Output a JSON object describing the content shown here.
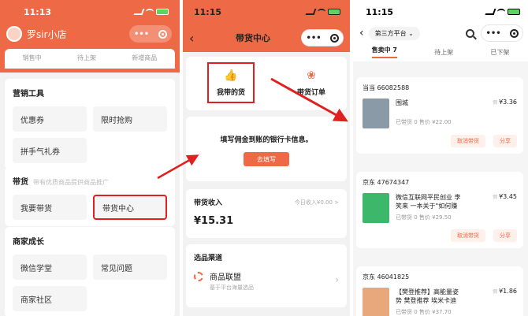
{
  "status_time": "11:13",
  "status_time_2": "11:15",
  "status_time_3": "11:15",
  "panel1": {
    "shop_name": "罗sir小店",
    "order_status": [
      "销售中",
      "待上架",
      "新增商品"
    ],
    "marketing": {
      "title": "营销工具",
      "items": [
        "优惠券",
        "限时抢购",
        "拼手气礼券"
      ]
    },
    "goods": {
      "title": "带货",
      "hint": "带有优质商品提供商品推广",
      "items": [
        "我要带货",
        "带货中心"
      ]
    },
    "growth": {
      "title": "商家成长",
      "items": [
        "微信学堂",
        "常见问题",
        "商家社区"
      ]
    }
  },
  "panel2": {
    "title": "带货中心",
    "my_goods": "我带的货",
    "orders": "带货订单",
    "bank_text": "填写佣金到账的银行卡信息。",
    "bank_button": "去填写",
    "income_title": "带货收入",
    "income_today": "今日收入¥0.00 >",
    "income_value": "¥15.31",
    "channel_title": "选品渠道",
    "channel_name": "商品联盟",
    "channel_sub": "基于平台海量选品"
  },
  "panel3": {
    "platform": "第三方平台",
    "tabs": [
      "售卖中 7",
      "待上架",
      "已下架"
    ],
    "products": [
      {
        "shop": "当当 66082588",
        "name": "围城",
        "meta": "已带货 0 售价 ¥22.00",
        "price": "¥3.36",
        "cover": "#8a9aa6"
      },
      {
        "shop": "京东 47674347",
        "name": "微信互联网平民创业 李笑来 一本关于\"如何赚",
        "meta": "已带货 0 售价 ¥29.50",
        "price": "¥3.45",
        "cover": "#3db86b"
      },
      {
        "shop": "京东 46041825",
        "name": "【樊登推荐】高能量姿势 樊登推荐 埃米卡迪",
        "meta": "已带货 0 售价 ¥37.70",
        "price": "¥1.86",
        "cover": "#e8a87c"
      }
    ],
    "price_tag": "佣",
    "btn_cancel": "取消带货",
    "btn_share": "分享"
  },
  "colors": {
    "accent": "#ee6a47",
    "highlight": "#e02020"
  }
}
